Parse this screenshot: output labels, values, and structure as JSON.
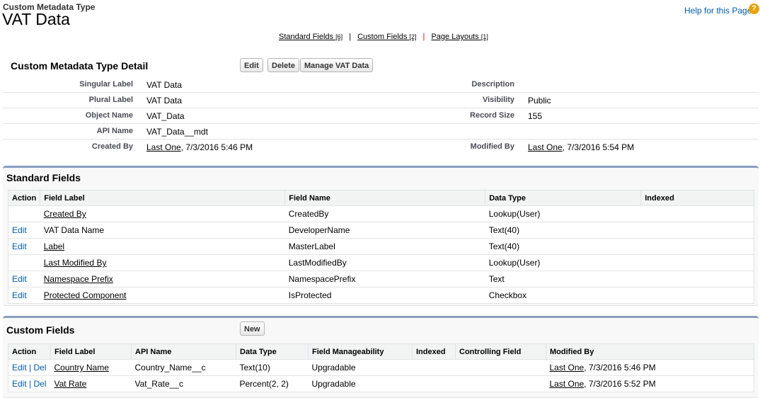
{
  "header": {
    "subtitle": "Custom Metadata Type",
    "title": "VAT Data",
    "help": "Help for this Page",
    "help_icon": "question-icon"
  },
  "links": [
    {
      "label": "Standard Fields",
      "count": "[6]"
    },
    {
      "label": "Custom Fields",
      "count": "[2]"
    },
    {
      "label": "Page Layouts",
      "count": "[1]"
    }
  ],
  "detail": {
    "title": "Custom Metadata Type Detail",
    "buttons": {
      "edit": "Edit",
      "delete": "Delete",
      "manage": "Manage VAT Data"
    },
    "rows": [
      {
        "l1": "Singular Label",
        "v1": "VAT Data",
        "l2": "Description",
        "v2": ""
      },
      {
        "l1": "Plural Label",
        "v1": "VAT Data",
        "l2": "Visibility",
        "v2": "Public"
      },
      {
        "l1": "Object Name",
        "v1": "VAT_Data",
        "l2": "Record Size",
        "v2": "155"
      },
      {
        "l1": "API Name",
        "v1": "VAT_Data__mdt",
        "l2": "",
        "v2": ""
      }
    ],
    "created_by_label": "Created By",
    "created_by_user": "Last One",
    "created_by_date": ", 7/3/2016 5:46 PM",
    "modified_by_label": "Modified By",
    "modified_by_user": "Last One",
    "modified_by_date": ", 7/3/2016 5:54 PM"
  },
  "standard": {
    "title": "Standard Fields",
    "headers": [
      "Action",
      "Field Label",
      "Field Name",
      "Data Type",
      "Indexed"
    ],
    "rows": [
      {
        "action": "",
        "label": "Created By",
        "link": true,
        "name": "CreatedBy",
        "type": "Lookup(User)"
      },
      {
        "action": "Edit",
        "label": "VAT Data Name",
        "link": false,
        "name": "DeveloperName",
        "type": "Text(40)"
      },
      {
        "action": "Edit",
        "label": "Label",
        "link": true,
        "name": "MasterLabel",
        "type": "Text(40)"
      },
      {
        "action": "",
        "label": "Last Modified By",
        "link": true,
        "name": "LastModifiedBy",
        "type": "Lookup(User)"
      },
      {
        "action": "Edit",
        "label": "Namespace Prefix",
        "link": true,
        "name": "NamespacePrefix",
        "type": "Text"
      },
      {
        "action": "Edit",
        "label": "Protected Component",
        "link": true,
        "name": "IsProtected",
        "type": "Checkbox"
      }
    ]
  },
  "custom": {
    "title": "Custom Fields",
    "new": "New",
    "headers": [
      "Action",
      "Field Label",
      "API Name",
      "Data Type",
      "Field Manageability",
      "Indexed",
      "Controlling Field",
      "Modified By"
    ],
    "edit": "Edit",
    "sep": " | ",
    "del": "Del",
    "rows": [
      {
        "label": "Country Name",
        "api": "Country_Name__c",
        "type": "Text(10)",
        "manage": "Upgradable",
        "user": "Last One",
        "date": ", 7/3/2016 5:46 PM"
      },
      {
        "label": "Vat Rate",
        "api": "Vat_Rate__c",
        "type": "Percent(2, 2)",
        "manage": "Upgradable",
        "user": "Last One",
        "date": ", 7/3/2016 5:52 PM"
      }
    ]
  }
}
